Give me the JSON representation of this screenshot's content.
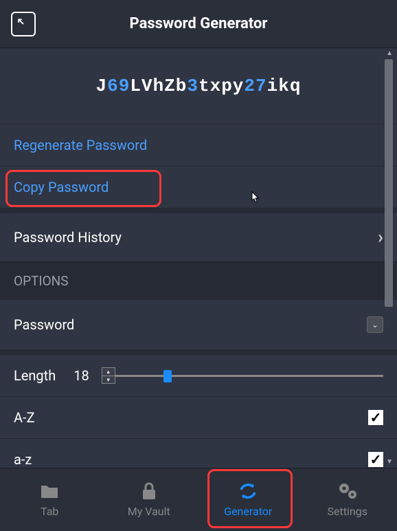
{
  "header": {
    "title": "Password Generator"
  },
  "password": {
    "segments": [
      {
        "text": "J",
        "type": "char"
      },
      {
        "text": "69",
        "type": "num"
      },
      {
        "text": "LVhZb",
        "type": "char"
      },
      {
        "text": "3",
        "type": "num"
      },
      {
        "text": "txpy",
        "type": "char"
      },
      {
        "text": "27",
        "type": "num"
      },
      {
        "text": "ikq",
        "type": "char"
      }
    ],
    "seg0": "J",
    "seg1": "69",
    "seg2": "LVhZb",
    "seg3": "3",
    "seg4": "txpy",
    "seg5": "27",
    "seg6": "ikq"
  },
  "actions": {
    "regenerate": "Regenerate Password",
    "copy": "Copy Password",
    "history": "Password History"
  },
  "options": {
    "header": "OPTIONS",
    "type_selected": "Password",
    "length_label": "Length",
    "length_value": "18",
    "upper_label": "A-Z",
    "lower_label": "a-z",
    "upper_checked": true,
    "lower_checked": true
  },
  "nav": {
    "tab": "Tab",
    "vault": "My Vault",
    "generator": "Generator",
    "settings": "Settings"
  }
}
